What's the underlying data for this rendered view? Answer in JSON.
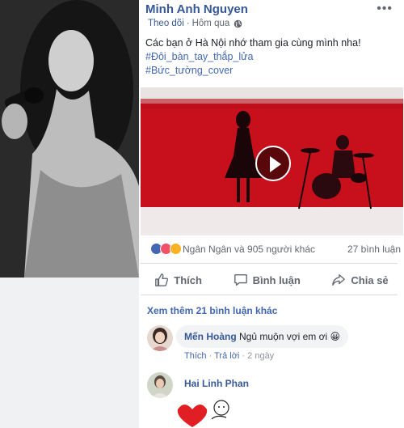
{
  "post": {
    "author": "Minh Anh Nguyen",
    "more_label": "•••",
    "follow_label": "Theo dõi",
    "separator": "·",
    "time": "Hôm qua",
    "privacy_icon": "globe-icon",
    "text": "Các bạn ở Hà Nội nhớ tham gia cùng mình nha!",
    "hashtags": [
      "#Đôi_bàn_tay_thắp_lửa",
      "#Bức_tường_cover"
    ]
  },
  "reactions": {
    "types": [
      "like",
      "love",
      "haha"
    ],
    "summary": "Ngân Ngân và 905 người khác",
    "comments": "27 bình luận"
  },
  "actions": {
    "like": "Thích",
    "comment": "Bình luận",
    "share": "Chia sẻ"
  },
  "more_comments": "Xem thêm 21 bình luận khác",
  "comments": [
    {
      "author": "Mến Hoàng",
      "text": "Ngủ muộn vợi em ơi 😀",
      "like_label": "Thích",
      "reply_label": "Trả lời",
      "time": "2 ngày"
    },
    {
      "author": "Hai Linh Phan"
    }
  ],
  "colors": {
    "brand": "#4267b2",
    "name": "#365899",
    "video_red": "#c8101c"
  }
}
